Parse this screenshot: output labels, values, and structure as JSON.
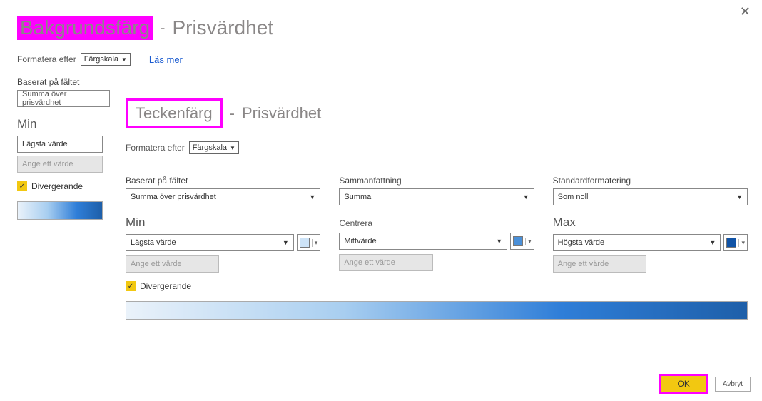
{
  "back": {
    "title": "Bakgrundsfärg",
    "subject": "Prisvärdhet",
    "format_by_label": "Formatera efter",
    "format_by_value": "Färgskala",
    "learn_more": "Läs mer",
    "based_on_label": "Baserat på fältet",
    "based_on_value": "Summa över prisvärdhet",
    "min_heading": "Min",
    "min_dd": "Lägsta värde",
    "min_placeholder": "Ange ett värde",
    "diverging": "Divergerande"
  },
  "front": {
    "title": "Teckenfärg",
    "subject": "Prisvärdhet",
    "format_by_label": "Formatera efter",
    "format_by_value": "Färgskala",
    "based_on_label": "Baserat på fältet",
    "based_on_value": "Summa över prisvärdhet",
    "summ_label": "Sammanfattning",
    "summ_value": "Summa",
    "default_label": "Standardformatering",
    "default_value": "Som noll",
    "min_heading": "Min",
    "min_dd": "Lägsta värde",
    "min_placeholder": "Ange ett värde",
    "center_heading": "Centrera",
    "center_dd": "Mittvärde",
    "center_placeholder": "Ange ett värde",
    "max_heading": "Max",
    "max_dd": "Högsta värde",
    "max_placeholder": "Ange ett värde",
    "diverging": "Divergerande",
    "ok": "OK",
    "cancel": "Avbryt",
    "colors": {
      "min": "#cde3f7",
      "center": "#4a90d9",
      "max": "#1053a6"
    }
  }
}
